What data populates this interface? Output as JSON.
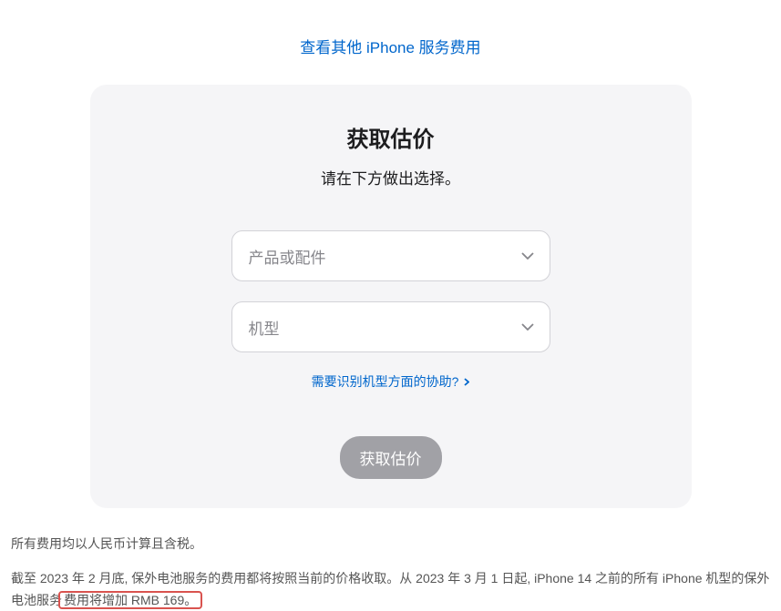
{
  "top_link": "查看其他 iPhone 服务费用",
  "card": {
    "title": "获取估价",
    "subtitle": "请在下方做出选择。",
    "select_product_placeholder": "产品或配件",
    "select_model_placeholder": "机型",
    "help_link": "需要识别机型方面的协助?",
    "submit_button": "获取估价"
  },
  "footer": {
    "para1": "所有费用均以人民币计算且含税。",
    "para2_prefix": "截至 2023 年 2 月底, 保外电池服务的费用都将按照当前的价格收取。从 2023 年 3 月 1 日起, iPhone 14 之前的所有 iPhone 机型的保外电池服务",
    "para2_highlight": "费用将增加 RMB 169。"
  }
}
